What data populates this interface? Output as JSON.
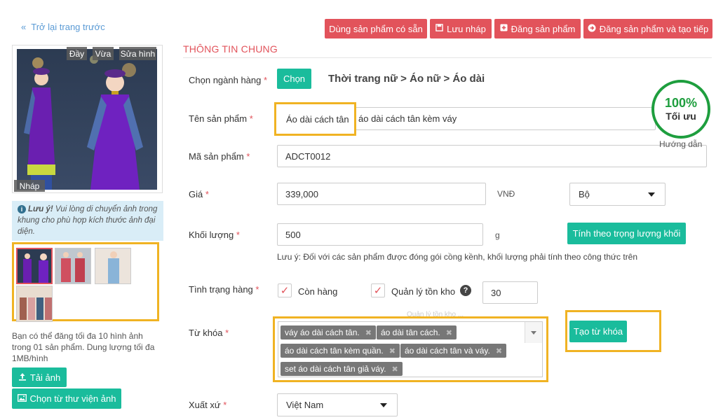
{
  "nav": {
    "back_label": "Trở lại trang trước"
  },
  "toolbar": {
    "use_existing_label": "Dùng sản phẩm có sẵn",
    "save_draft_label": "Lưu nháp",
    "publish_label": "Đăng sản phẩm",
    "publish_new_label": "Đăng sản phẩm và tạo tiếp"
  },
  "image_panel": {
    "fill_label": "Đầy",
    "fit_label": "Vừa",
    "edit_label": "Sửa hình",
    "draft_label": "Nháp",
    "note_title": "Lưu ý!",
    "note_text": " Vui lòng di chuyển ảnh trong khung cho phù hợp kích thước ảnh đại diện.",
    "limit_text": "Bạn có thể đăng tối đa 10 hình ảnh trong 01 sản phẩm. Dung lượng tối đa 1MB/hình",
    "upload_label": "Tải ảnh",
    "library_label": "Chọn từ thư viện ảnh"
  },
  "form": {
    "section_title": "THÔNG TIN CHUNG",
    "category": {
      "label": "Chọn ngành hàng",
      "button": "Chọn",
      "path": "Thời trang nữ > Áo nữ > Áo dài"
    },
    "name": {
      "label": "Tên sản phẩm",
      "value": "Áo dài cách tân",
      "value_rest": "áo dài cách tân kèm váy"
    },
    "sku": {
      "label": "Mã sản phẩm",
      "value": "ADCT0012"
    },
    "price": {
      "label": "Giá",
      "value": "339,000",
      "currency": "VNĐ",
      "unit": "Bộ"
    },
    "weight": {
      "label": "Khối lượng",
      "value": "500",
      "unit": "g",
      "calc_button": "Tính theo trọng lượng khối",
      "note": "Lưu ý: Đối với các sản phẩm được đóng gói cồng kềnh, khối lượng phải tính theo công thức trên"
    },
    "stock": {
      "label": "Tình trạng hàng",
      "in_stock": "Còn hàng",
      "manage": "Quản lý tồn kho",
      "qty": "30",
      "faded_hint": "Quản lý tồn kho ..."
    },
    "keywords": {
      "label": "Từ khóa",
      "tags": [
        "váy áo dài cách tân.",
        "áo dài tân cách.",
        "áo dài cách tân kèm quần.",
        "áo dài cách tân và váy.",
        "set áo dài cách tân giả váy."
      ],
      "create_button": "Tạo từ khóa"
    },
    "origin": {
      "label": "Xuất xứ",
      "value": "Việt Nam"
    }
  },
  "score": {
    "percent": "100%",
    "label": "Tối ưu",
    "guide": "Hướng dẫn"
  },
  "colors": {
    "accent_red": "#e2535b",
    "accent_green": "#1abc9c",
    "highlight": "#f0b323",
    "score_green": "#1e9e3e"
  }
}
